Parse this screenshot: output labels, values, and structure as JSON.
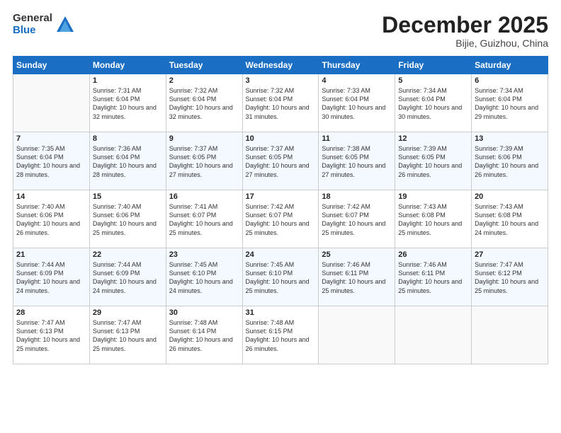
{
  "logo": {
    "general": "General",
    "blue": "Blue"
  },
  "title": "December 2025",
  "location": "Bijie, Guizhou, China",
  "days_of_week": [
    "Sunday",
    "Monday",
    "Tuesday",
    "Wednesday",
    "Thursday",
    "Friday",
    "Saturday"
  ],
  "weeks": [
    [
      {
        "day": "",
        "empty": true
      },
      {
        "day": "1",
        "sunrise": "7:31 AM",
        "sunset": "6:04 PM",
        "daylight": "10 hours and 32 minutes."
      },
      {
        "day": "2",
        "sunrise": "7:32 AM",
        "sunset": "6:04 PM",
        "daylight": "10 hours and 32 minutes."
      },
      {
        "day": "3",
        "sunrise": "7:32 AM",
        "sunset": "6:04 PM",
        "daylight": "10 hours and 31 minutes."
      },
      {
        "day": "4",
        "sunrise": "7:33 AM",
        "sunset": "6:04 PM",
        "daylight": "10 hours and 30 minutes."
      },
      {
        "day": "5",
        "sunrise": "7:34 AM",
        "sunset": "6:04 PM",
        "daylight": "10 hours and 30 minutes."
      },
      {
        "day": "6",
        "sunrise": "7:34 AM",
        "sunset": "6:04 PM",
        "daylight": "10 hours and 29 minutes."
      }
    ],
    [
      {
        "day": "7",
        "sunrise": "7:35 AM",
        "sunset": "6:04 PM",
        "daylight": "10 hours and 28 minutes."
      },
      {
        "day": "8",
        "sunrise": "7:36 AM",
        "sunset": "6:04 PM",
        "daylight": "10 hours and 28 minutes."
      },
      {
        "day": "9",
        "sunrise": "7:37 AM",
        "sunset": "6:05 PM",
        "daylight": "10 hours and 27 minutes."
      },
      {
        "day": "10",
        "sunrise": "7:37 AM",
        "sunset": "6:05 PM",
        "daylight": "10 hours and 27 minutes."
      },
      {
        "day": "11",
        "sunrise": "7:38 AM",
        "sunset": "6:05 PM",
        "daylight": "10 hours and 27 minutes."
      },
      {
        "day": "12",
        "sunrise": "7:39 AM",
        "sunset": "6:05 PM",
        "daylight": "10 hours and 26 minutes."
      },
      {
        "day": "13",
        "sunrise": "7:39 AM",
        "sunset": "6:06 PM",
        "daylight": "10 hours and 26 minutes."
      }
    ],
    [
      {
        "day": "14",
        "sunrise": "7:40 AM",
        "sunset": "6:06 PM",
        "daylight": "10 hours and 26 minutes."
      },
      {
        "day": "15",
        "sunrise": "7:40 AM",
        "sunset": "6:06 PM",
        "daylight": "10 hours and 25 minutes."
      },
      {
        "day": "16",
        "sunrise": "7:41 AM",
        "sunset": "6:07 PM",
        "daylight": "10 hours and 25 minutes."
      },
      {
        "day": "17",
        "sunrise": "7:42 AM",
        "sunset": "6:07 PM",
        "daylight": "10 hours and 25 minutes."
      },
      {
        "day": "18",
        "sunrise": "7:42 AM",
        "sunset": "6:07 PM",
        "daylight": "10 hours and 25 minutes."
      },
      {
        "day": "19",
        "sunrise": "7:43 AM",
        "sunset": "6:08 PM",
        "daylight": "10 hours and 25 minutes."
      },
      {
        "day": "20",
        "sunrise": "7:43 AM",
        "sunset": "6:08 PM",
        "daylight": "10 hours and 24 minutes."
      }
    ],
    [
      {
        "day": "21",
        "sunrise": "7:44 AM",
        "sunset": "6:09 PM",
        "daylight": "10 hours and 24 minutes."
      },
      {
        "day": "22",
        "sunrise": "7:44 AM",
        "sunset": "6:09 PM",
        "daylight": "10 hours and 24 minutes."
      },
      {
        "day": "23",
        "sunrise": "7:45 AM",
        "sunset": "6:10 PM",
        "daylight": "10 hours and 24 minutes."
      },
      {
        "day": "24",
        "sunrise": "7:45 AM",
        "sunset": "6:10 PM",
        "daylight": "10 hours and 25 minutes."
      },
      {
        "day": "25",
        "sunrise": "7:46 AM",
        "sunset": "6:11 PM",
        "daylight": "10 hours and 25 minutes."
      },
      {
        "day": "26",
        "sunrise": "7:46 AM",
        "sunset": "6:11 PM",
        "daylight": "10 hours and 25 minutes."
      },
      {
        "day": "27",
        "sunrise": "7:47 AM",
        "sunset": "6:12 PM",
        "daylight": "10 hours and 25 minutes."
      }
    ],
    [
      {
        "day": "28",
        "sunrise": "7:47 AM",
        "sunset": "6:13 PM",
        "daylight": "10 hours and 25 minutes."
      },
      {
        "day": "29",
        "sunrise": "7:47 AM",
        "sunset": "6:13 PM",
        "daylight": "10 hours and 25 minutes."
      },
      {
        "day": "30",
        "sunrise": "7:48 AM",
        "sunset": "6:14 PM",
        "daylight": "10 hours and 26 minutes."
      },
      {
        "day": "31",
        "sunrise": "7:48 AM",
        "sunset": "6:15 PM",
        "daylight": "10 hours and 26 minutes."
      },
      {
        "day": "",
        "empty": true
      },
      {
        "day": "",
        "empty": true
      },
      {
        "day": "",
        "empty": true
      }
    ]
  ]
}
